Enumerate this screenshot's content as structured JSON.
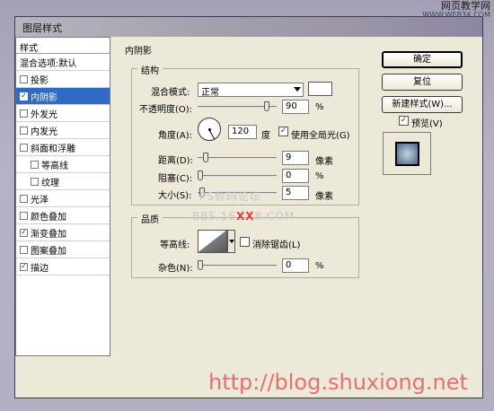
{
  "window": {
    "title": "图层样式"
  },
  "watermark": {
    "site_top": "网页教学网",
    "site_url": "WWW.WEB3X.COM",
    "line1": "PS数码论坛",
    "line2_a": "BBS.16",
    "line2_b": "XX",
    "line2_c": "8.COM",
    "url": "http://blog.shuxiong.net"
  },
  "left_list": {
    "header": "样式",
    "items": [
      {
        "label": "混合选项:默认",
        "checkbox": false,
        "checked": false,
        "indent": false,
        "selected": false
      },
      {
        "label": "投影",
        "checkbox": true,
        "checked": false,
        "indent": false,
        "selected": false
      },
      {
        "label": "内阴影",
        "checkbox": true,
        "checked": true,
        "indent": false,
        "selected": true
      },
      {
        "label": "外发光",
        "checkbox": true,
        "checked": false,
        "indent": false,
        "selected": false
      },
      {
        "label": "内发光",
        "checkbox": true,
        "checked": false,
        "indent": false,
        "selected": false
      },
      {
        "label": "斜面和浮雕",
        "checkbox": true,
        "checked": false,
        "indent": false,
        "selected": false
      },
      {
        "label": "等高线",
        "checkbox": true,
        "checked": false,
        "indent": true,
        "selected": false
      },
      {
        "label": "纹理",
        "checkbox": true,
        "checked": false,
        "indent": true,
        "selected": false
      },
      {
        "label": "光泽",
        "checkbox": true,
        "checked": false,
        "indent": false,
        "selected": false
      },
      {
        "label": "颜色叠加",
        "checkbox": true,
        "checked": false,
        "indent": false,
        "selected": false
      },
      {
        "label": "渐变叠加",
        "checkbox": true,
        "checked": true,
        "indent": false,
        "selected": false
      },
      {
        "label": "图案叠加",
        "checkbox": true,
        "checked": false,
        "indent": false,
        "selected": false
      },
      {
        "label": "描边",
        "checkbox": true,
        "checked": true,
        "indent": false,
        "selected": false
      }
    ]
  },
  "panel": {
    "title": "内阴影",
    "structure": {
      "title": "结构",
      "blend_mode_label": "混合模式:",
      "blend_mode_value": "正常",
      "opacity_label": "不透明度(O):",
      "opacity_value": "90",
      "opacity_fraction": 0.9,
      "percent": "%",
      "angle_label": "角度(A):",
      "angle_value": "120",
      "angle_unit": "度",
      "global_light_label": "使用全局光(G)",
      "global_light_checked": true,
      "distance_label": "距离(D):",
      "distance_value": "9",
      "choke_label": "阻塞(C):",
      "choke_value": "0",
      "size_label": "大小(S):",
      "size_value": "5",
      "px_unit": "像素"
    },
    "quality": {
      "title": "品质",
      "contour_label": "等高线:",
      "antialias_label": "消除锯齿(L)",
      "antialias_checked": false,
      "noise_label": "杂色(N):",
      "noise_value": "0",
      "percent": "%"
    }
  },
  "buttons": {
    "ok": "确定",
    "reset": "复位",
    "new_style": "新建样式(W)...",
    "preview_label": "预览(V)",
    "preview_checked": true
  },
  "colors": {
    "selection": "#316ac5",
    "dialog_bg": "#ece9d8",
    "watermark_url": "#e67070"
  }
}
